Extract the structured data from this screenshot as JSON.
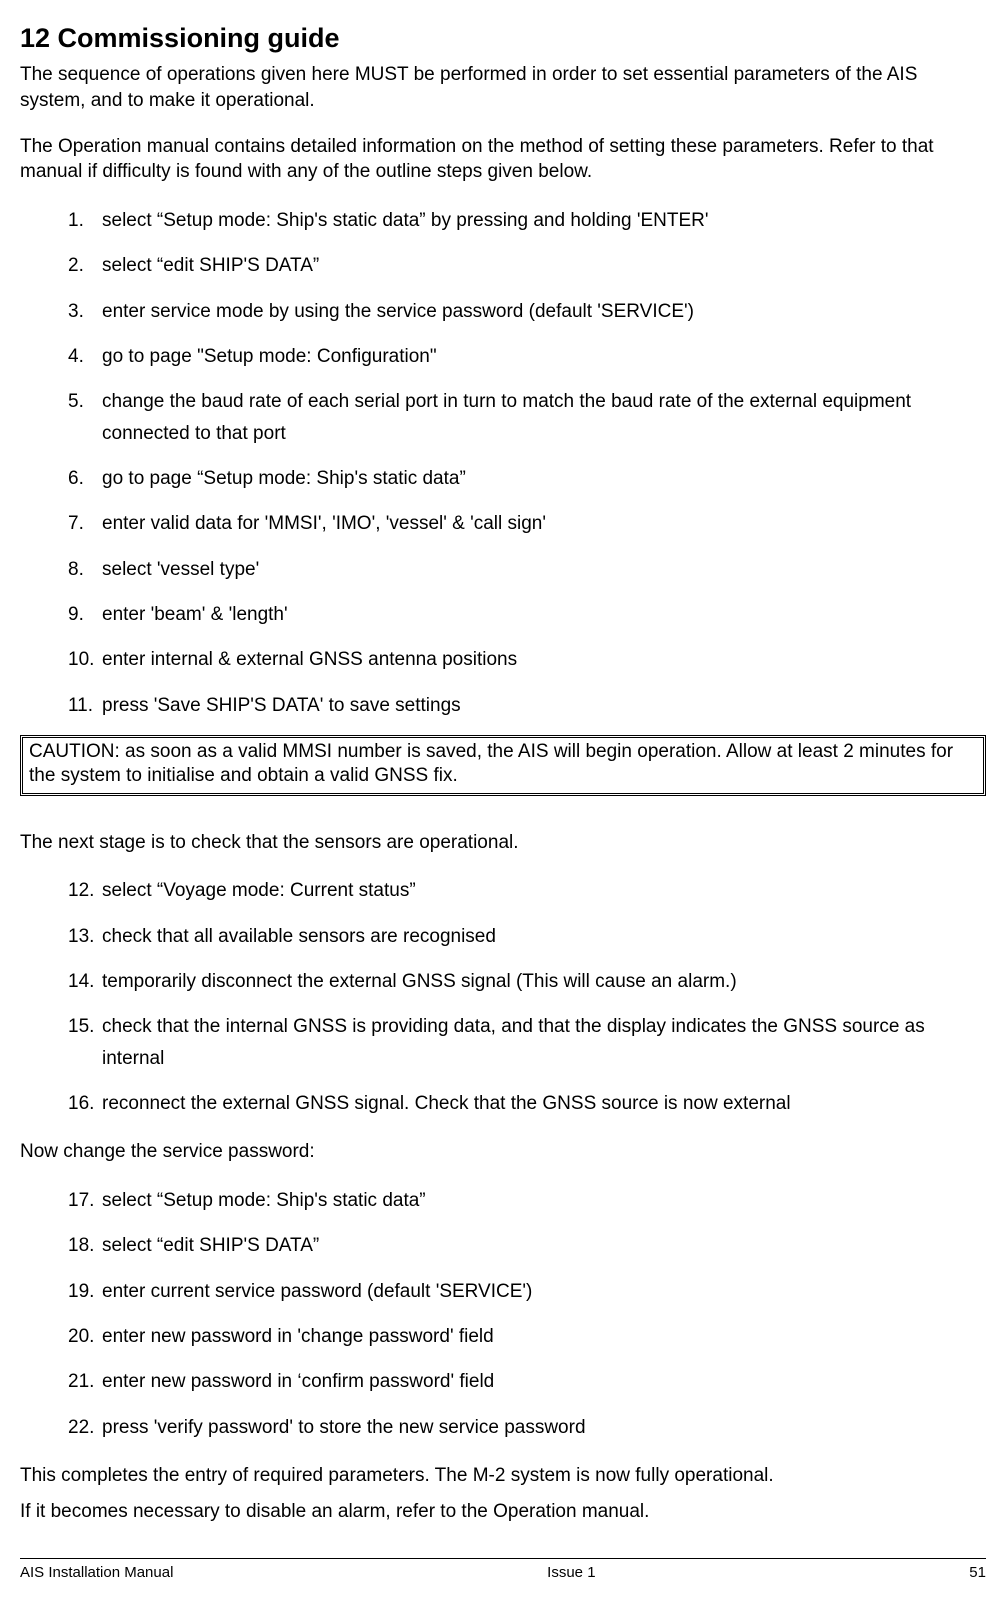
{
  "heading": "12  Commissioning guide",
  "intro1": "The sequence of operations given here MUST be performed in order to set essential parameters of the AIS system, and to make it operational.",
  "intro2": "The Operation manual contains detailed information on the method of setting these parameters. Refer to that manual if difficulty is found with any of the outline steps given below.",
  "list1": [
    "select “Setup mode: Ship's static data” by pressing and holding 'ENTER'",
    "select “edit SHIP'S DATA”",
    "enter service mode by using the service password (default 'SERVICE')",
    "go to page \"Setup mode: Configuration\"",
    "change the baud rate of each serial port in turn to match the baud rate of the external equipment connected to that port",
    "go to page “Setup mode: Ship's static data”",
    "enter valid data for 'MMSI', 'IMO', 'vessel' & 'call sign'",
    "select 'vessel type'",
    "enter 'beam' & 'length'",
    "enter internal & external GNSS antenna positions",
    "press 'Save SHIP'S DATA' to save settings"
  ],
  "caution": "CAUTION: as soon as a valid MMSI number is saved, the AIS will begin operation. Allow at least 2 minutes for the system to initialise and obtain a valid GNSS fix.",
  "mid1": "The next stage is to check that the sensors are operational.",
  "list2_start": 12,
  "list2": [
    "select “Voyage mode: Current status”",
    "check that all available sensors are recognised",
    "temporarily disconnect the external GNSS signal (This will cause an alarm.)",
    "check that the internal GNSS is providing data, and that the display indicates the GNSS source as internal",
    "reconnect the external GNSS signal. Check that the GNSS source is now external"
  ],
  "mid2": "Now change the service password:",
  "list3_start": 17,
  "list3": [
    "select “Setup mode: Ship's static data”",
    "select “edit SHIP'S DATA”",
    "enter current service password (default 'SERVICE')",
    "enter new password in 'change password' field",
    "enter new password in ‘confirm password' field",
    "press 'verify password' to store the new service password"
  ],
  "closing1": "This completes the entry of required parameters. The M-2 system is now fully operational.",
  "closing2": "If it becomes necessary to disable an alarm, refer to the Operation manual.",
  "footer_left": "AIS Installation Manual",
  "footer_center": "Issue 1",
  "footer_right": "51"
}
